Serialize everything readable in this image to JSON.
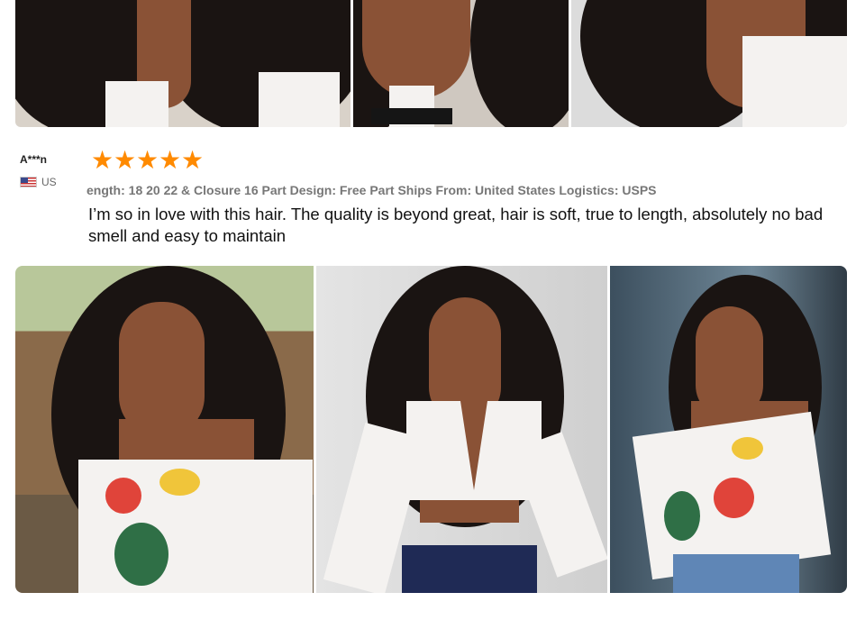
{
  "review": {
    "reviewer": "A***n",
    "country": "US",
    "flag_icon": "us-flag-icon",
    "rating": 5,
    "rating_max": 5,
    "sku": "ength: 18 20 22 & Closure 16 Part Design: Free Part Ships From: United States Logistics: USPS",
    "text": " I’m so in love with this hair. The quality is beyond great, hair is soft, true to length, absolutely no bad smell and easy to maintain"
  },
  "colors": {
    "star": "#ff8a00",
    "name": "#222222",
    "sku": "#777777",
    "text": "#111111"
  }
}
